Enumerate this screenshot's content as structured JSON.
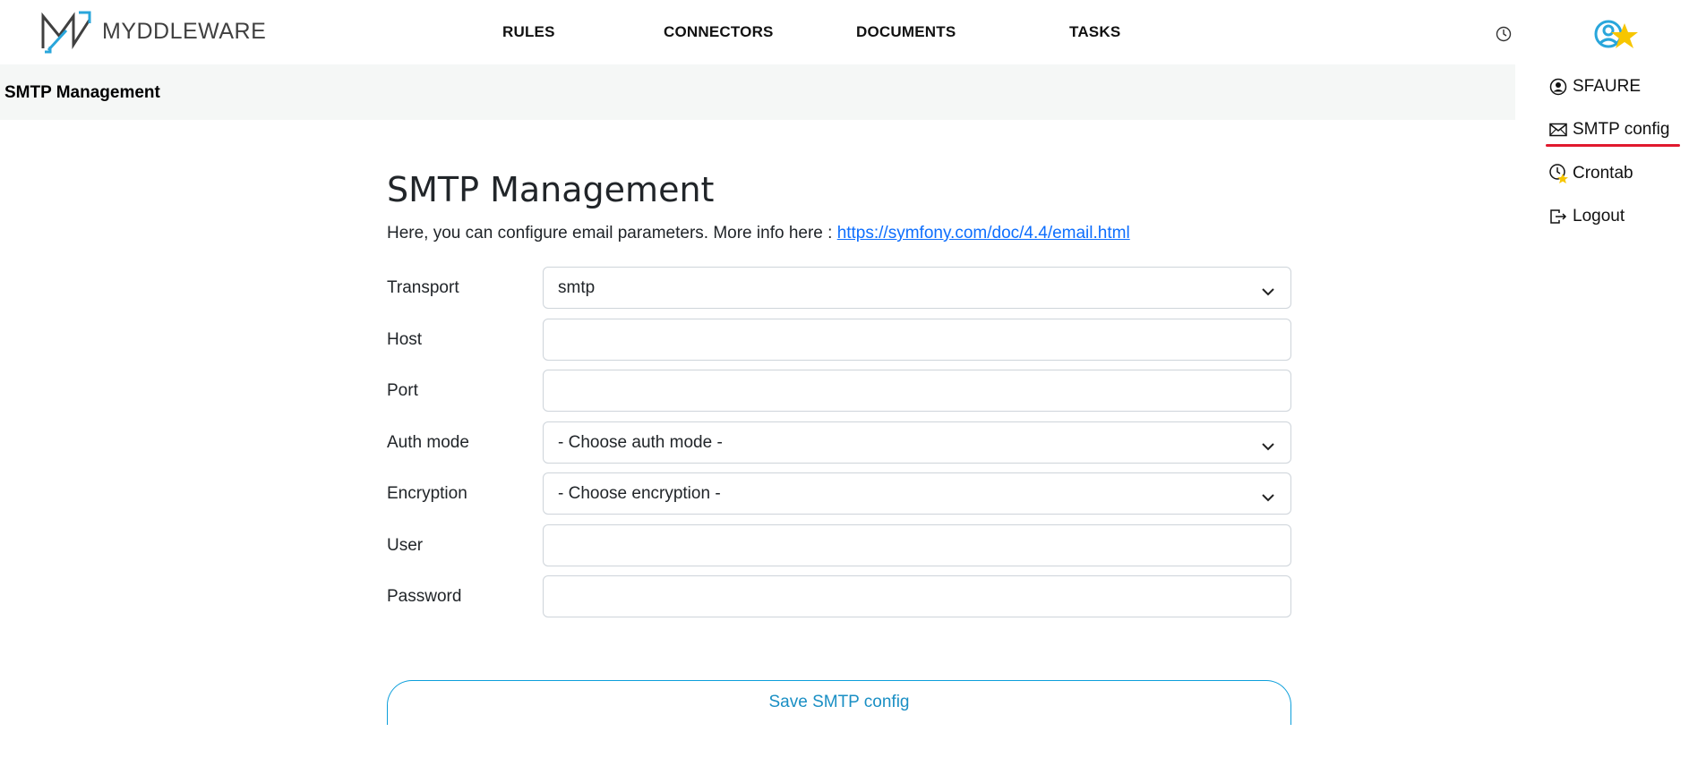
{
  "brand": {
    "name": "MYDDLEWARE"
  },
  "nav": {
    "items": [
      {
        "label": "RULES"
      },
      {
        "label": "CONNECTORS"
      },
      {
        "label": "DOCUMENTS"
      },
      {
        "label": "TASKS"
      }
    ]
  },
  "subheader": {
    "title": "SMTP Management"
  },
  "user_menu": {
    "items": [
      {
        "label": "SFAURE",
        "icon": "user-circle-icon"
      },
      {
        "label": "SMTP config",
        "icon": "envelope-icon"
      },
      {
        "label": "Crontab",
        "icon": "clock-icon"
      },
      {
        "label": "Logout",
        "icon": "logout-icon"
      }
    ]
  },
  "main": {
    "title": "SMTP Management",
    "intro_text": "Here, you can configure email parameters. More info here : ",
    "intro_link": "https://symfony.com/doc/4.4/email.html",
    "fields": {
      "transport": {
        "label": "Transport",
        "value": "smtp"
      },
      "host": {
        "label": "Host",
        "value": ""
      },
      "port": {
        "label": "Port",
        "value": ""
      },
      "auth_mode": {
        "label": "Auth mode",
        "value": "- Choose auth mode -"
      },
      "encryption": {
        "label": "Encryption",
        "value": "- Choose encryption -"
      },
      "user": {
        "label": "User",
        "value": ""
      },
      "password": {
        "label": "Password",
        "value": ""
      }
    },
    "save_label": "Save SMTP config"
  },
  "colors": {
    "accent": "#1a8fc4",
    "link": "#0d6efd",
    "highlight_underline": "#e0192e",
    "subheader_bg": "#f5f7f6",
    "star": "#f7c600"
  }
}
